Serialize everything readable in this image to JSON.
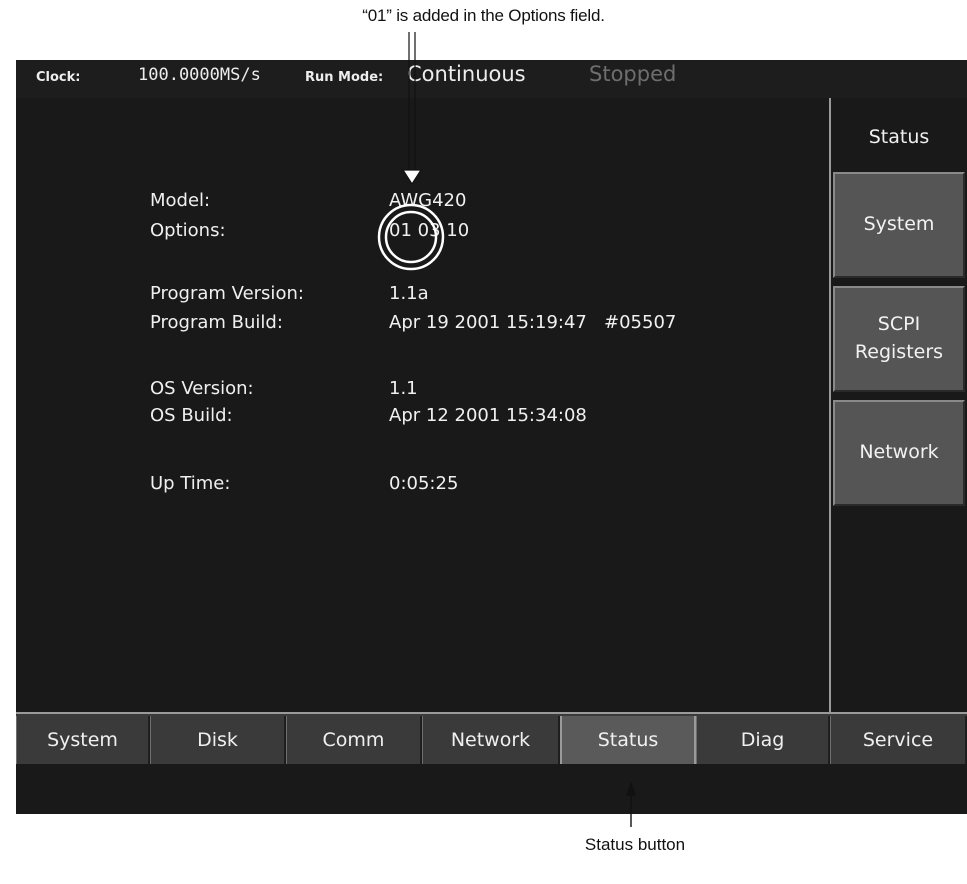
{
  "annotations": {
    "top": "“01” is added in the Options field.",
    "bottom": "Status button"
  },
  "topbar": {
    "clock_label": "Clock:",
    "clock_value": "100.0000MS/s",
    "runmode_label": "Run Mode:",
    "runmode_value": "Continuous",
    "state": "Stopped"
  },
  "info": {
    "model_label": "Model:",
    "model_value": "AWG420",
    "options_label": "Options:",
    "options_value": "01 03 10",
    "program_version_label": "Program Version:",
    "program_version_value": "1.1a",
    "program_build_label": "Program Build:",
    "program_build_value": "Apr 19 2001 15:19:47   #05507",
    "os_version_label": "OS Version:",
    "os_version_value": "1.1",
    "os_build_label": "OS Build:",
    "os_build_value": "Apr 12 2001 15:34:08",
    "uptime_label": "Up Time:",
    "uptime_value": "0:05:25"
  },
  "side_menu": {
    "title": "Status",
    "system": "System",
    "scpi_line1": "SCPI",
    "scpi_line2": "Registers",
    "network": "Network"
  },
  "bottom_menu": {
    "system": "System",
    "disk": "Disk",
    "comm": "Comm",
    "network": "Network",
    "status": "Status",
    "diag": "Diag",
    "service": "Service"
  },
  "colors": {
    "screen_bg": "#191919",
    "button_bg": "#3a3a3a",
    "button_active": "#5a5a5a",
    "side_button": "#555555",
    "text": "#f0f0f0"
  }
}
